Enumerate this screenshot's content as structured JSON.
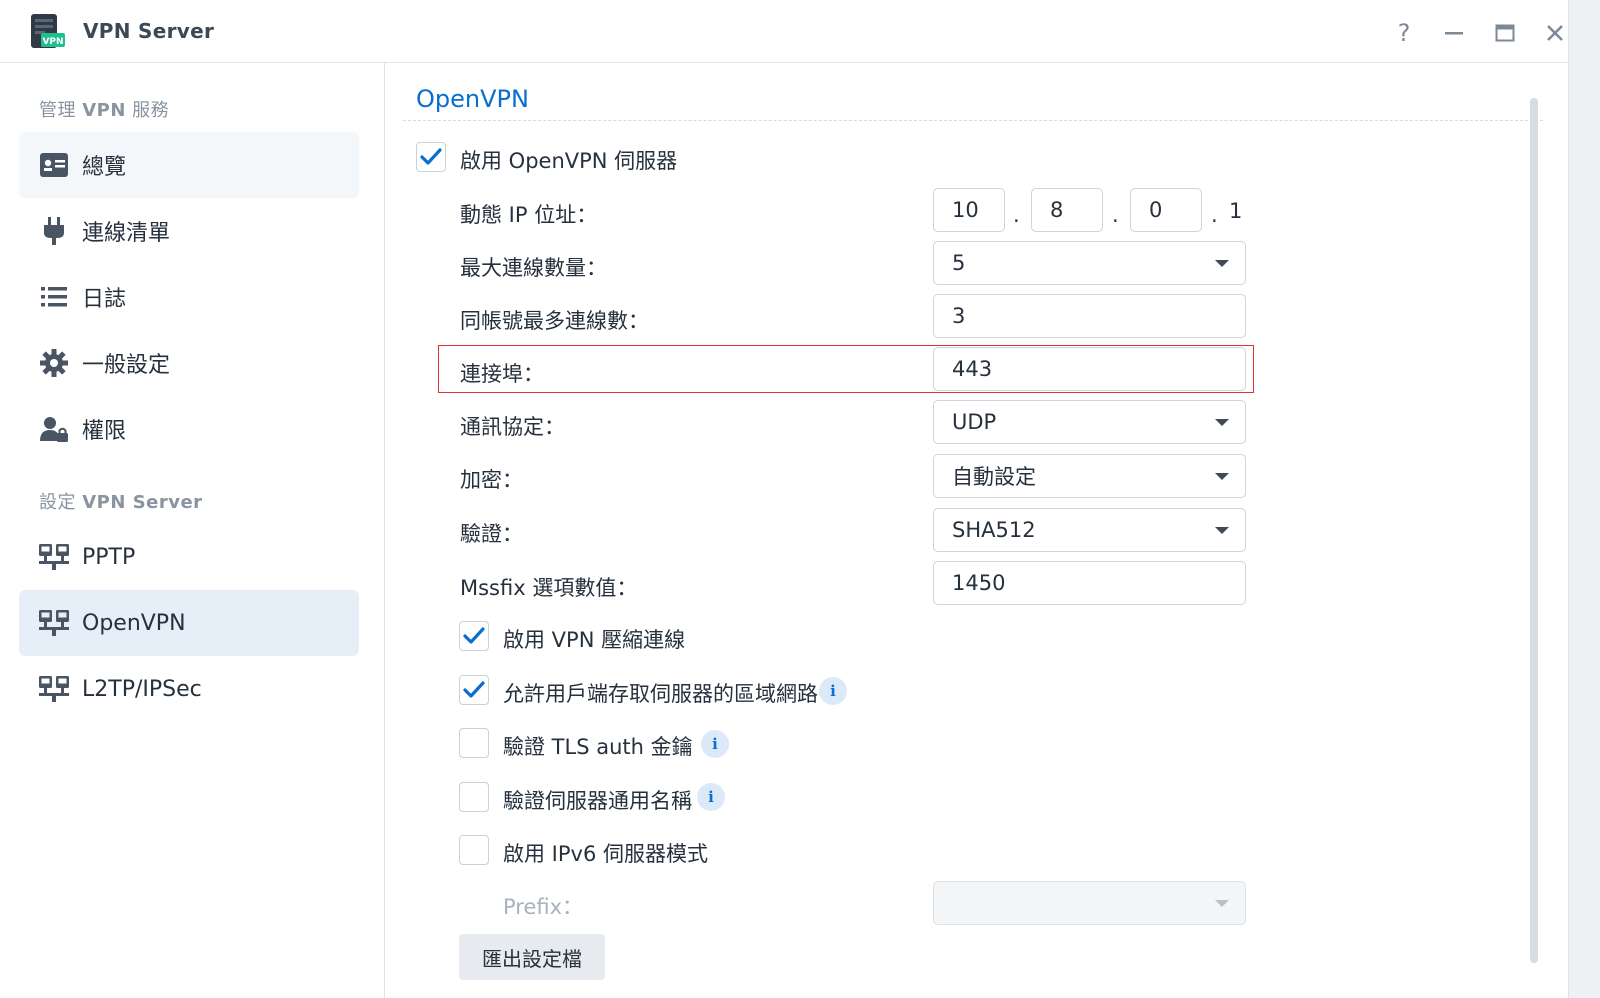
{
  "window": {
    "title": "VPN Server",
    "icon_badge": "VPN",
    "help_glyph": "?",
    "minimize_glyph": "—",
    "close_glyph": "✕"
  },
  "sidebar": {
    "section1": {
      "prefix": "管理",
      "bold": "VPN",
      "suffix": "服務"
    },
    "section2": {
      "prefix": "設定",
      "bold": "VPN Server",
      "suffix": ""
    },
    "items": [
      {
        "label": "總覽",
        "icon": "overview-card-icon"
      },
      {
        "label": "連線清單",
        "icon": "plug-icon"
      },
      {
        "label": "日誌",
        "icon": "list-icon"
      },
      {
        "label": "一般設定",
        "icon": "gear-icon"
      },
      {
        "label": "權限",
        "icon": "user-lock-icon"
      },
      {
        "label": "PPTP",
        "icon": "network-icon"
      },
      {
        "label": "OpenVPN",
        "icon": "network-icon"
      },
      {
        "label": "L2TP/IPSec",
        "icon": "network-icon"
      }
    ],
    "active_item": "OpenVPN",
    "hover_item": "總覽"
  },
  "main": {
    "title": "OpenVPN",
    "enable_server": {
      "label": "啟用 OpenVPN 伺服器",
      "checked": true
    },
    "dynamic_ip": {
      "label": "動態 IP 位址：",
      "octets": [
        "10",
        "8",
        "0"
      ],
      "last": "1",
      "dot": "."
    },
    "max_connections": {
      "label": "最大連線數量：",
      "value": "5"
    },
    "max_per_account": {
      "label": "同帳號最多連線數：",
      "value": "3"
    },
    "port": {
      "label": "連接埠：",
      "value": "443"
    },
    "protocol": {
      "label": "通訊協定：",
      "value": "UDP"
    },
    "encryption": {
      "label": "加密：",
      "value": "自動設定"
    },
    "authentication": {
      "label": "驗證：",
      "value": "SHA512"
    },
    "mssfix": {
      "label": "Mssfix 選項數值：",
      "value": "1450"
    },
    "options": [
      {
        "label": "啟用 VPN 壓縮連線",
        "checked": true,
        "info": false
      },
      {
        "label": "允許用戶端存取伺服器的區域網路",
        "checked": true,
        "info": true
      },
      {
        "label": "驗證 TLS auth 金鑰",
        "checked": false,
        "info": true
      },
      {
        "label": "驗證伺服器通用名稱",
        "checked": false,
        "info": true
      },
      {
        "label": "啟用 IPv6 伺服器模式",
        "checked": false,
        "info": false
      }
    ],
    "prefix": {
      "label": "Prefix：",
      "value": "",
      "disabled": true
    },
    "export_button": "匯出設定檔",
    "info_glyph": "i"
  },
  "colors": {
    "accent": "#0a6ed1",
    "highlight_border": "#e0302f",
    "sidebar_active": "#e6eef7",
    "icon_dark": "#4a5563",
    "badge_green": "#1fbf8f"
  }
}
